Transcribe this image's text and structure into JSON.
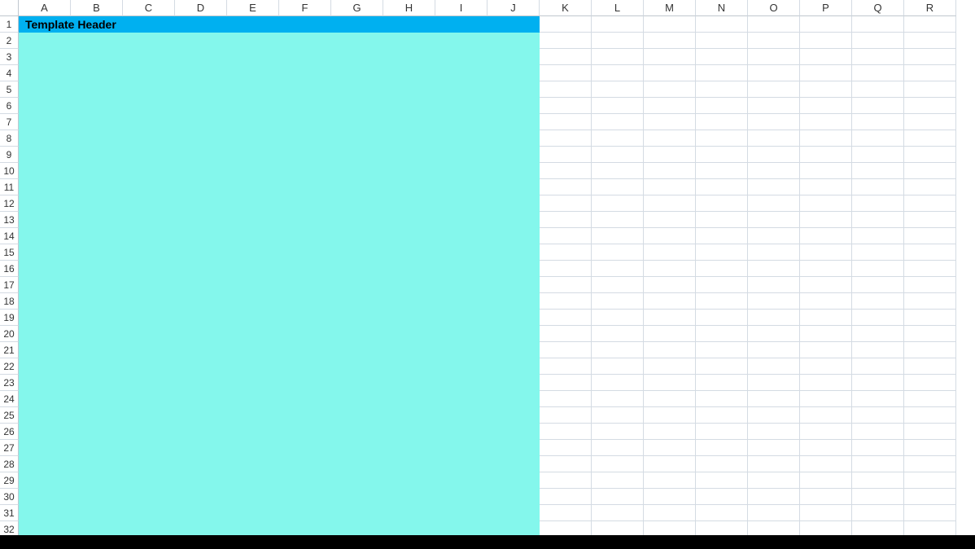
{
  "spreadsheet": {
    "column_headers": [
      "A",
      "B",
      "C",
      "D",
      "E",
      "F",
      "G",
      "H",
      "I",
      "J",
      "K",
      "L",
      "M",
      "N",
      "O",
      "P",
      "Q",
      "R"
    ],
    "row_headers": [
      "1",
      "2",
      "3",
      "4",
      "5",
      "6",
      "7",
      "8",
      "9",
      "10",
      "11",
      "12",
      "13",
      "14",
      "15",
      "16",
      "17",
      "18",
      "19",
      "20",
      "21",
      "22",
      "23",
      "24",
      "25",
      "26",
      "27",
      "28",
      "29",
      "30",
      "31",
      "32"
    ],
    "header_cell": {
      "text": "Template Header",
      "color": "#00b0f0"
    },
    "body_fill_color": "#84f7ec",
    "filled_columns": "A-J"
  }
}
